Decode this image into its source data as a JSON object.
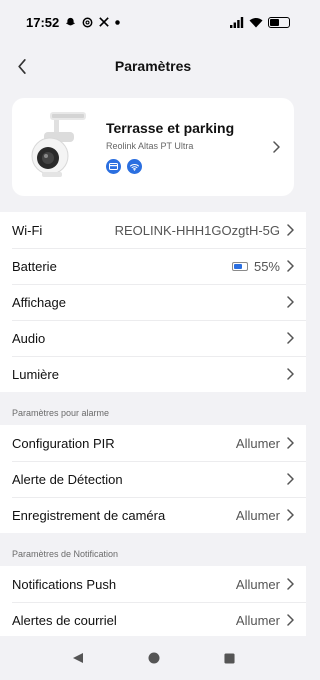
{
  "status_bar": {
    "time": "17:52",
    "left_icons": [
      "ghost-icon",
      "threads-icon",
      "x-icon",
      "dot-icon"
    ],
    "right_icons": [
      "signal-icon",
      "wifi-icon",
      "battery-icon"
    ]
  },
  "nav": {
    "title": "Paramètres",
    "back_icon": "chevron-left-icon"
  },
  "device": {
    "name": "Terrasse et parking",
    "model": "Reolink Altas PT Ultra",
    "badges": [
      "card-icon",
      "wifi-icon"
    ]
  },
  "general": [
    {
      "label": "Wi-Fi",
      "value": "REOLINK-HHH1GOzgtH-5G"
    },
    {
      "label": "Batterie",
      "value": "55%",
      "battery_level": 0.55
    },
    {
      "label": "Affichage",
      "value": ""
    },
    {
      "label": "Audio",
      "value": ""
    },
    {
      "label": "Lumière",
      "value": ""
    }
  ],
  "alarm_section": {
    "title": "Paramètres pour alarme",
    "items": [
      {
        "label": "Configuration PIR",
        "value": "Allumer"
      },
      {
        "label": "Alerte de Détection",
        "value": ""
      },
      {
        "label": "Enregistrement de caméra",
        "value": "Allumer"
      }
    ]
  },
  "notification_section": {
    "title": "Paramètres de Notification",
    "items": [
      {
        "label": "Notifications Push",
        "value": "Allumer"
      },
      {
        "label": "Alertes de courriel",
        "value": "Allumer"
      }
    ]
  },
  "colors": {
    "accent": "#2b6fe0",
    "background": "#f2f2f5",
    "card": "#ffffff"
  },
  "system_nav": [
    "back-triangle-icon",
    "home-circle-icon",
    "recents-square-icon"
  ]
}
